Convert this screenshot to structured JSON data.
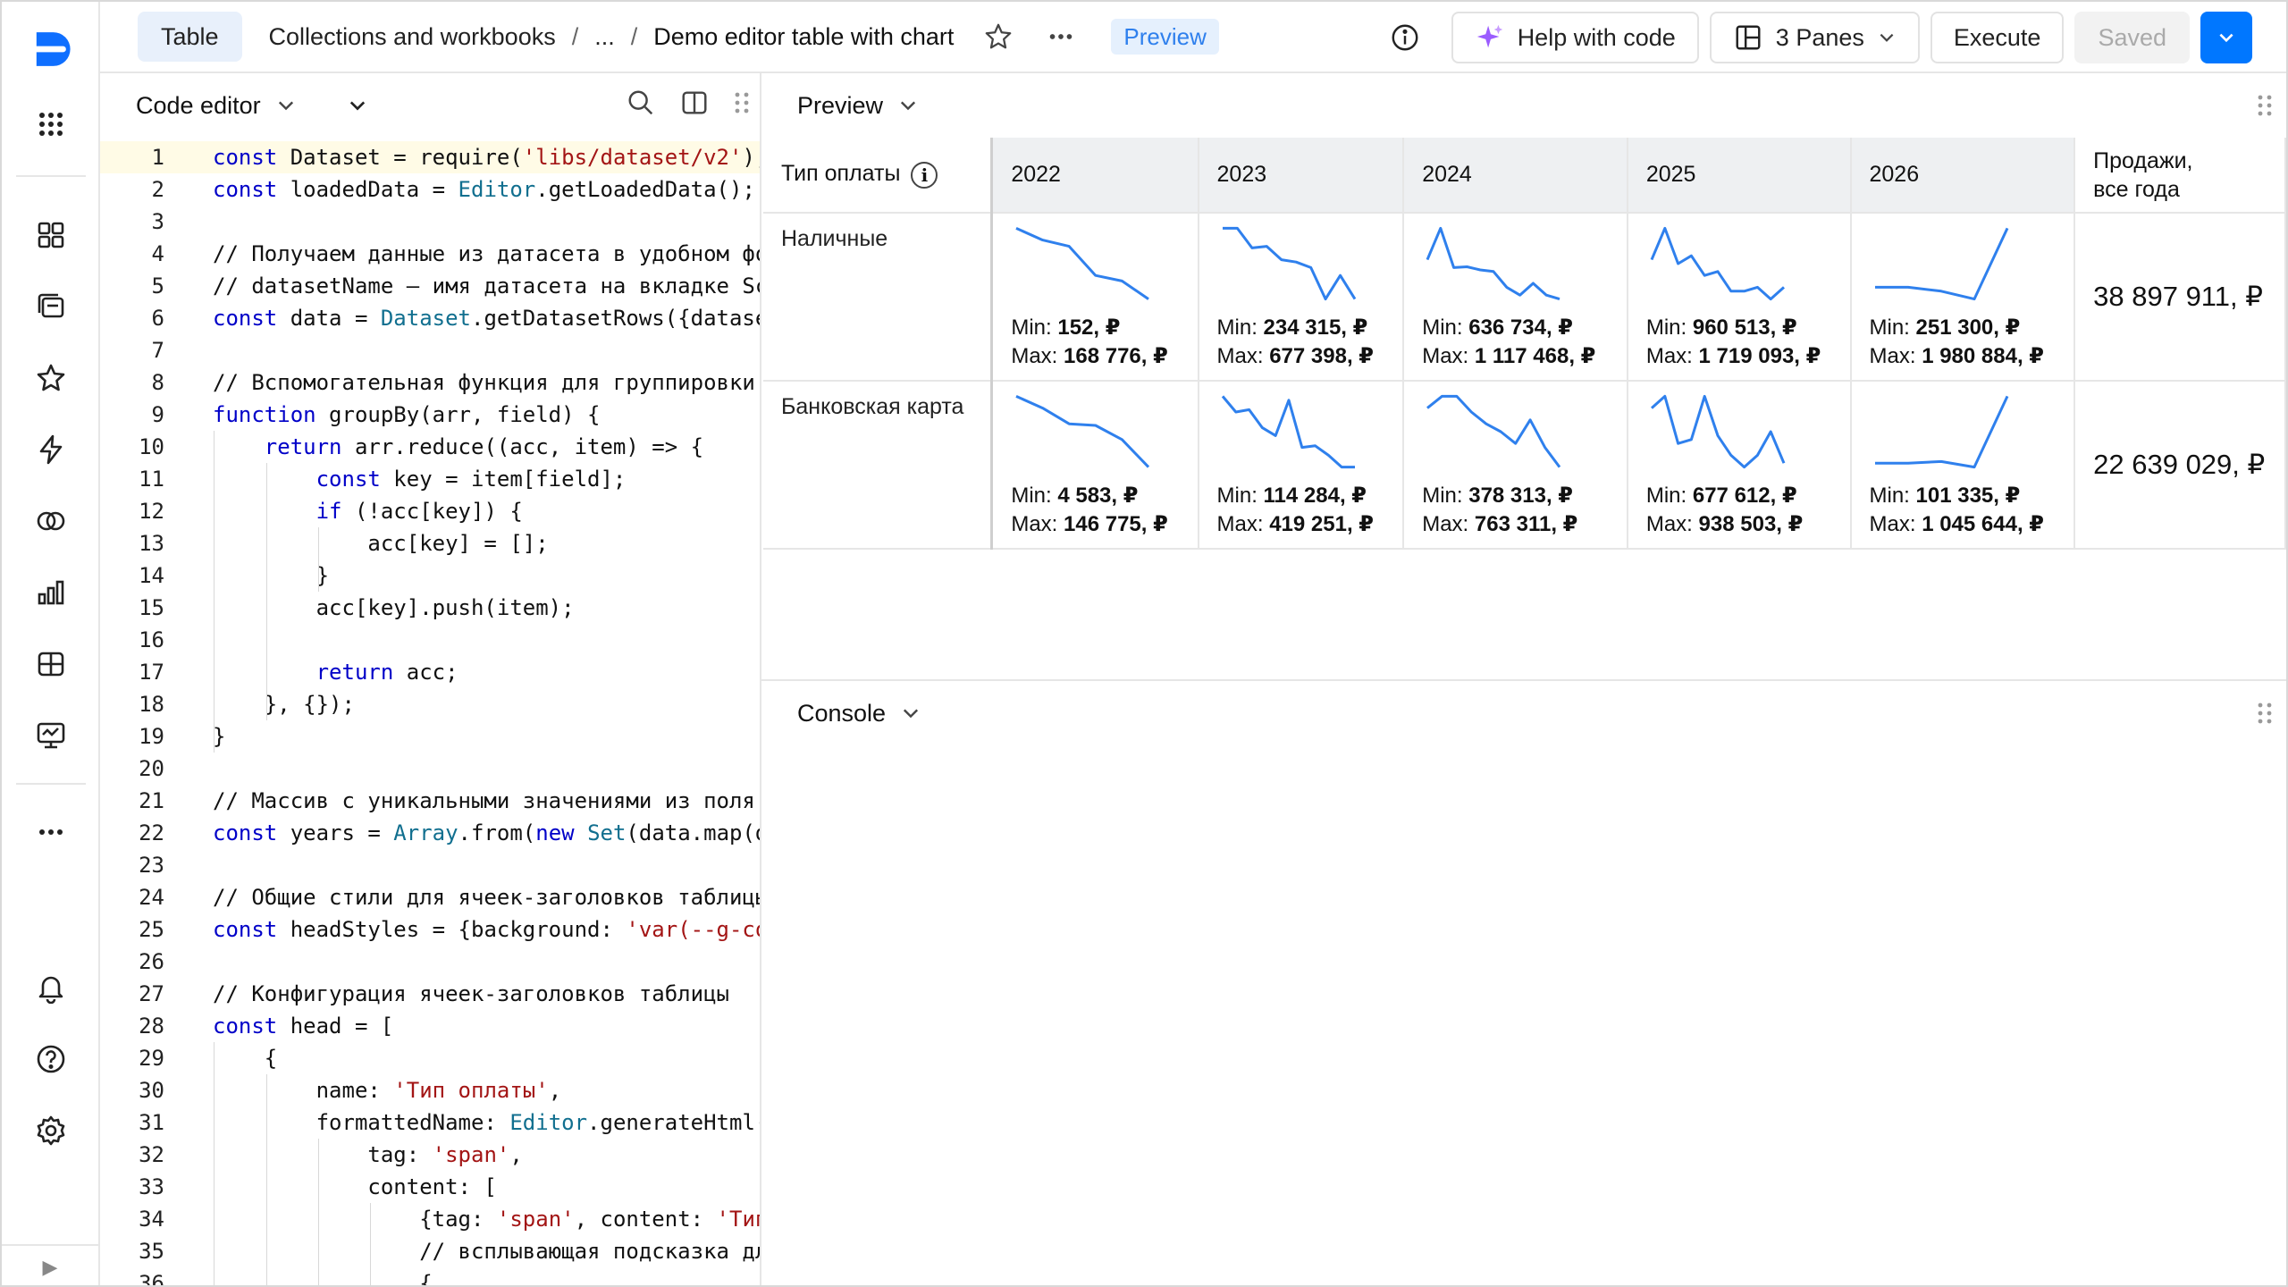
{
  "header": {
    "type_button": "Table",
    "breadcrumbs": [
      "Collections and workbooks",
      "..."
    ],
    "title": "Demo editor table with chart",
    "preview_badge": "Preview",
    "help_with_code": "Help with code",
    "panes": "3 Panes",
    "execute": "Execute",
    "saved": "Saved"
  },
  "editor": {
    "title": "Code editor",
    "lines": [
      "const Dataset = require('libs/dataset/v2');",
      "const loadedData = Editor.getLoadedData();",
      "",
      "// Получаем данные из датасета в удобном фо",
      "// datasetName — имя датасета на вкладке Sc",
      "const data = Dataset.getDatasetRows({datase",
      "",
      "// Вспомогательная функция для группировки ",
      "function groupBy(arr, field) {",
      "    return arr.reduce((acc, item) => {",
      "        const key = item[field];",
      "        if (!acc[key]) {",
      "            acc[key] = [];",
      "        }",
      "        acc[key].push(item);",
      "",
      "        return acc;",
      "    }, {});",
      "}",
      "",
      "// Массив с уникальными значениями из поля ",
      "const years = Array.from(new Set(data.map(d",
      "",
      "// Общие стили для ячеек-заголовков таблицы",
      "const headStyles = {background: 'var(--g-co",
      "",
      "// Конфигурация ячеек-заголовков таблицы",
      "const head = [",
      "    {",
      "        name: 'Тип оплаты',",
      "        formattedName: Editor.generateHtml(",
      "            tag: 'span',",
      "            content: [",
      "                {tag: 'span', content: 'Тип",
      "                // всплывающая подсказка дл",
      "                {"
    ]
  },
  "preview": {
    "title": "Preview",
    "table": {
      "first_header": "Тип оплаты",
      "years": [
        "2022",
        "2023",
        "2024",
        "2025",
        "2026"
      ],
      "total_header_line1": "Продажи,",
      "total_header_line2": "все года",
      "rows": [
        {
          "name": "Наличные",
          "cells": [
            {
              "min": "Min: ",
              "min_v": "152, ₽",
              "max": "Max: ",
              "max_v": "168 776, ₽",
              "spark": [
                0.95,
                0.8,
                0.72,
                0.35,
                0.28,
                0.05
              ]
            },
            {
              "min": "Min: ",
              "min_v": "234 315, ₽",
              "max": "Max: ",
              "max_v": "677 398, ₽",
              "spark": [
                0.95,
                0.95,
                0.7,
                0.72,
                0.55,
                0.52,
                0.45,
                0.05,
                0.35,
                0.05
              ]
            },
            {
              "min": "Min: ",
              "min_v": "636 734, ₽",
              "max": "Max: ",
              "max_v": "1 117 468, ₽",
              "spark": [
                0.55,
                0.95,
                0.45,
                0.46,
                0.42,
                0.4,
                0.2,
                0.1,
                0.25,
                0.1,
                0.05
              ]
            },
            {
              "min": "Min: ",
              "min_v": "960 513, ₽",
              "max": "Max: ",
              "max_v": "1 719 093, ₽",
              "spark": [
                0.55,
                0.95,
                0.5,
                0.6,
                0.35,
                0.4,
                0.15,
                0.15,
                0.2,
                0.05,
                0.2
              ]
            },
            {
              "min": "Min: ",
              "min_v": "251 300, ₽",
              "max": "Max: ",
              "max_v": "1 980 884, ₽",
              "spark": [
                0.2,
                0.2,
                0.15,
                0.05,
                0.95
              ]
            }
          ],
          "total": "38 897 911, ₽"
        },
        {
          "name": "Банковская карта",
          "cells": [
            {
              "min": "Min: ",
              "min_v": "4 583, ₽",
              "max": "Max: ",
              "max_v": "146 775, ₽",
              "spark": [
                0.95,
                0.8,
                0.6,
                0.58,
                0.4,
                0.05
              ]
            },
            {
              "min": "Min: ",
              "min_v": "114 284, ₽",
              "max": "Max: ",
              "max_v": "419 251, ₽",
              "spark": [
                0.95,
                0.75,
                0.78,
                0.55,
                0.45,
                0.9,
                0.3,
                0.32,
                0.2,
                0.05,
                0.05
              ]
            },
            {
              "min": "Min: ",
              "min_v": "378 313, ₽",
              "max": "Max: ",
              "max_v": "763 311, ₽",
              "spark": [
                0.8,
                0.95,
                0.95,
                0.75,
                0.6,
                0.5,
                0.35,
                0.65,
                0.3,
                0.05
              ]
            },
            {
              "min": "Min: ",
              "min_v": "677 612, ₽",
              "max": "Max: ",
              "max_v": "938 503, ₽",
              "spark": [
                0.8,
                0.95,
                0.35,
                0.4,
                0.95,
                0.45,
                0.2,
                0.05,
                0.2,
                0.5,
                0.1
              ]
            },
            {
              "min": "Min: ",
              "min_v": "101 335, ₽",
              "max": "Max: ",
              "max_v": "1 045 644, ₽",
              "spark": [
                0.1,
                0.1,
                0.12,
                0.05,
                0.95
              ]
            }
          ],
          "total": "22 639 029, ₽"
        }
      ]
    }
  },
  "console": {
    "title": "Console"
  },
  "colors": {
    "accent": "#0077ff",
    "spark": "#2f80ed",
    "logo": "#0f6fff"
  }
}
